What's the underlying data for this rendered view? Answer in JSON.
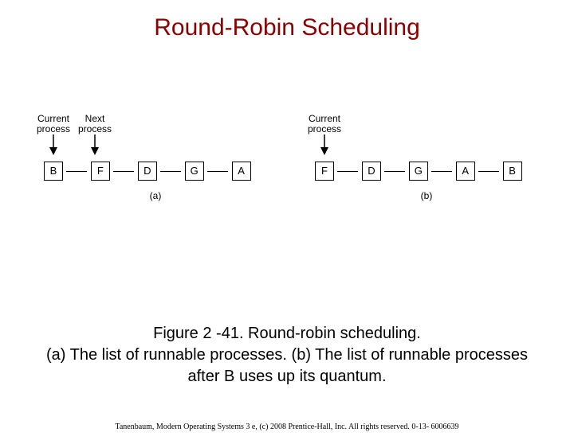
{
  "title": "Round-Robin Scheduling",
  "labels": {
    "current": "Current\nprocess",
    "next": "Next\nprocess"
  },
  "figures": {
    "a": {
      "processes": [
        "B",
        "F",
        "D",
        "G",
        "A"
      ],
      "sub": "(a)"
    },
    "b": {
      "processes": [
        "F",
        "D",
        "G",
        "A",
        "B"
      ],
      "sub": "(b)"
    }
  },
  "caption": "Figure 2 -41. Round-robin scheduling.\n(a) The list of runnable processes. (b) The list of runnable processes after B uses up its quantum.",
  "footer": "Tanenbaum, Modern Operating Systems 3 e, (c) 2008 Prentice-Hall, Inc. All rights reserved. 0-13- 6006639"
}
